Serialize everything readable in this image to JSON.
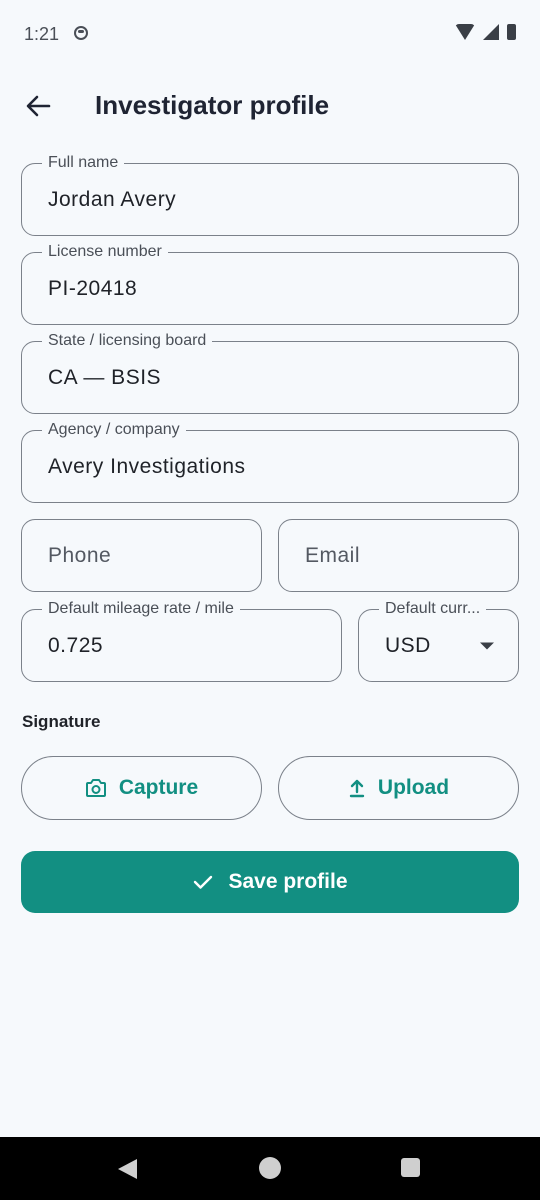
{
  "status_bar": {
    "time": "1:21"
  },
  "header": {
    "title": "Investigator profile"
  },
  "form": {
    "full_name": {
      "label": "Full name",
      "value": "Jordan Avery"
    },
    "license_number": {
      "label": "License number",
      "value": "PI-20418"
    },
    "state_board": {
      "label": "State / licensing board",
      "value": "CA — BSIS"
    },
    "agency": {
      "label": "Agency / company",
      "value": "Avery Investigations"
    },
    "phone": {
      "placeholder": "Phone"
    },
    "email": {
      "placeholder": "Email"
    },
    "mileage_rate": {
      "label": "Default mileage rate / mile",
      "value": "0.725"
    },
    "currency": {
      "label": "Default curr...",
      "value": "USD"
    }
  },
  "signature": {
    "section_label": "Signature",
    "capture_label": "Capture",
    "upload_label": "Upload"
  },
  "actions": {
    "save_label": "Save profile"
  },
  "colors": {
    "accent": "#128f82",
    "background": "#f6f9fc",
    "title": "#1f2433",
    "outline": "#7b818a"
  },
  "icons": [
    "back-arrow-icon",
    "camera-icon",
    "upload-icon",
    "check-icon"
  ]
}
